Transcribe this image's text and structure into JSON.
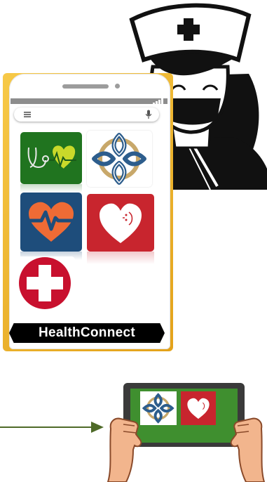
{
  "app": {
    "name": "HealthConnect"
  },
  "colors": {
    "stethoscope_tile": "#20741f",
    "pulse_tile": "#1e4d7b",
    "heart_tile": "#c8252e",
    "cross": "#c8102e",
    "celtic_blue": "#2d5d8c",
    "celtic_gold": "#c8a86a",
    "phone_frame": "#e3a21a",
    "tablet_screen": "#3f8f2f",
    "arrow": "#4e6a28"
  },
  "icons": {
    "phone": [
      "menu-icon",
      "microphone-icon",
      "signal-icon"
    ],
    "apps": [
      "stethoscope-heart-icon",
      "celtic-knot-icon",
      "heart-pulse-icon",
      "smiling-heart-icon",
      "medical-cross-icon"
    ]
  }
}
